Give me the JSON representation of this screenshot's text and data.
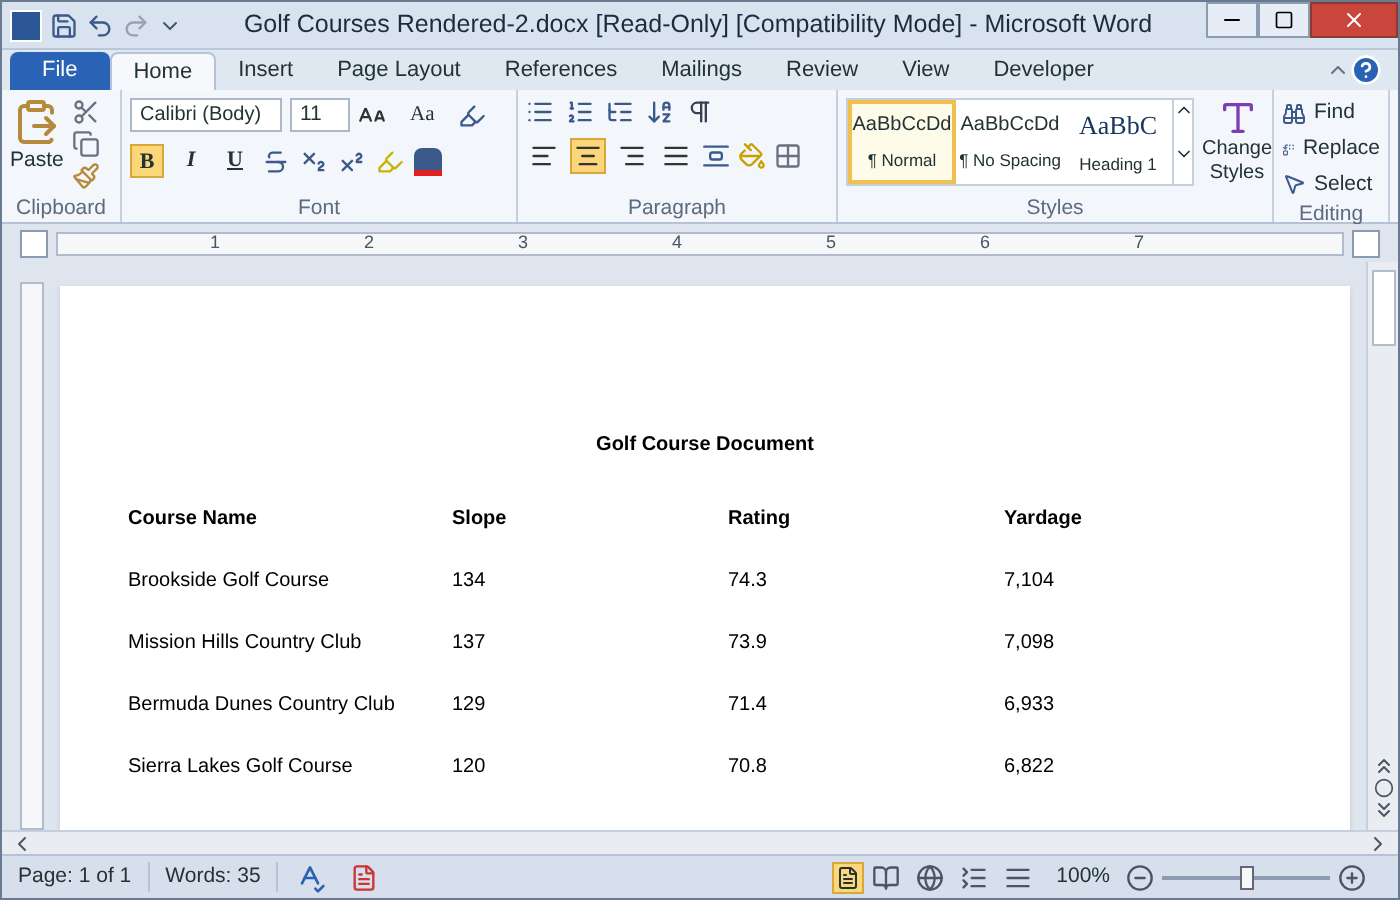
{
  "window": {
    "title": "Golf Courses Rendered-2.docx [Read-Only] [Compatibility Mode] - Microsoft Word"
  },
  "tabs": [
    {
      "label": "File",
      "kind": "file",
      "selected": false
    },
    {
      "label": "Home",
      "kind": "tab",
      "selected": true
    },
    {
      "label": "Insert",
      "kind": "tab",
      "selected": false
    },
    {
      "label": "Page Layout",
      "kind": "tab",
      "selected": false
    },
    {
      "label": "References",
      "kind": "tab",
      "selected": false
    },
    {
      "label": "Mailings",
      "kind": "tab",
      "selected": false
    },
    {
      "label": "Review",
      "kind": "tab",
      "selected": false
    },
    {
      "label": "View",
      "kind": "tab",
      "selected": false
    },
    {
      "label": "Developer",
      "kind": "tab",
      "selected": false
    }
  ],
  "ribbon": {
    "clipboard": {
      "paste": "Paste",
      "label": "Clipboard"
    },
    "font": {
      "name": "Calibri (Body)",
      "size": "11",
      "case_button": "Aa",
      "label": "Font",
      "format_buttons": [
        {
          "label": "B",
          "on": true
        },
        {
          "label": "I",
          "on": false
        },
        {
          "label": "U",
          "on": false
        }
      ]
    },
    "paragraph": {
      "label": "Paragraph",
      "alignments": [
        {
          "selected": false
        },
        {
          "selected": true
        },
        {
          "selected": false
        },
        {
          "selected": false
        }
      ]
    },
    "styles": {
      "label": "Styles",
      "change_styles": "Change Styles",
      "items": [
        {
          "preview": "AaBbCcDd",
          "name": "¶ Normal",
          "kind": "body",
          "selected": true
        },
        {
          "preview": "AaBbCcDd",
          "name": "¶ No Spacing",
          "kind": "body",
          "selected": false
        },
        {
          "preview": "AaBbC",
          "name": "Heading 1",
          "kind": "heading",
          "selected": false
        }
      ]
    },
    "editing": {
      "label": "Editing",
      "items": [
        "Find",
        "Replace",
        "Select"
      ]
    }
  },
  "ruler": {
    "numbers": [
      "1",
      "2",
      "3",
      "4",
      "5",
      "6",
      "7"
    ]
  },
  "document": {
    "title": "Golf Course Document",
    "table": {
      "columns": [
        "Course Name",
        "Slope",
        "Rating",
        "Yardage"
      ],
      "rows": [
        [
          "Brookside Golf Course",
          "134",
          "74.3",
          "7,104"
        ],
        [
          "Mission Hills Country Club",
          "137",
          "73.9",
          "7,098"
        ],
        [
          "Bermuda Dunes Country Club",
          "129",
          "71.4",
          "6,933"
        ],
        [
          "Sierra Lakes Golf Course",
          "120",
          "70.8",
          "6,822"
        ]
      ]
    }
  },
  "status_bar": {
    "page": "Page: 1 of 1",
    "words": "Words: 35",
    "zoom": "100%",
    "zoom_slider": {
      "level": 0.5
    }
  }
}
